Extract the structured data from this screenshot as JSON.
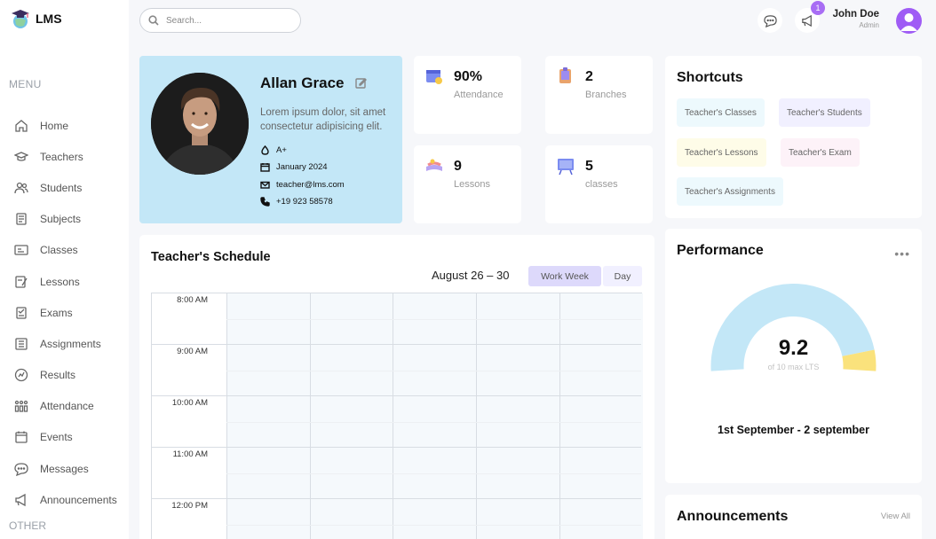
{
  "app": {
    "name": "LMS"
  },
  "sidebar": {
    "menu_title": "MENU",
    "other_title": "OTHER",
    "items": [
      {
        "label": "Home",
        "icon": "home-icon"
      },
      {
        "label": "Teachers",
        "icon": "teacher-icon"
      },
      {
        "label": "Students",
        "icon": "students-icon"
      },
      {
        "label": "Subjects",
        "icon": "subjects-icon"
      },
      {
        "label": "Classes",
        "icon": "classes-icon"
      },
      {
        "label": "Lessons",
        "icon": "lessons-icon"
      },
      {
        "label": "Exams",
        "icon": "exams-icon"
      },
      {
        "label": "Assignments",
        "icon": "assignments-icon"
      },
      {
        "label": "Results",
        "icon": "results-icon"
      },
      {
        "label": "Attendance",
        "icon": "attendance-icon"
      },
      {
        "label": "Events",
        "icon": "events-icon"
      },
      {
        "label": "Messages",
        "icon": "messages-icon"
      },
      {
        "label": "Announcements",
        "icon": "announcements-icon"
      }
    ]
  },
  "topbar": {
    "search_placeholder": "Search...",
    "notification_count": "1",
    "user_name": "John Doe",
    "user_role": "Admin"
  },
  "profile": {
    "name": "Allan Grace",
    "description": "Lorem ipsum dolor, sit amet consectetur adipisicing elit.",
    "blood_type": "A+",
    "date": "January 2024",
    "email": "teacher@lms.com",
    "phone": "+19 923 58578"
  },
  "stats": [
    {
      "value": "90%",
      "label": "Attendance",
      "icon": "attendance-calendar-icon"
    },
    {
      "value": "2",
      "label": "Branches",
      "icon": "branches-icon"
    },
    {
      "value": "9",
      "label": "Lessons",
      "icon": "lessons-book-icon"
    },
    {
      "value": "5",
      "label": "classes",
      "icon": "classes-board-icon"
    }
  ],
  "shortcuts": {
    "title": "Shortcuts",
    "items": [
      {
        "label": "Teacher's Classes",
        "color": "#edf9fd"
      },
      {
        "label": "Teacher's Students",
        "color": "#f1f0ff"
      },
      {
        "label": "Teacher's Lessons",
        "color": "#fefce8"
      },
      {
        "label": "Teacher's Exam",
        "color": "#fdf2f8"
      },
      {
        "label": "Teacher's Assignments",
        "color": "#edf9fd"
      }
    ]
  },
  "schedule": {
    "title": "Teacher's Schedule",
    "range": "August 26 – 30",
    "view_work_week": "Work Week",
    "view_day": "Day",
    "times": [
      "8:00 AM",
      "9:00 AM",
      "10:00 AM",
      "11:00 AM",
      "12:00 PM"
    ]
  },
  "performance": {
    "title": "Performance",
    "value": "9.2",
    "subtitle": "of 10 max LTS",
    "range": "1st September - 2 september",
    "score": 9.2,
    "max": 10,
    "colors": {
      "filled": "#c3e7f7",
      "rest": "#fae27c"
    }
  },
  "announcements": {
    "title": "Announcements",
    "view_all": "View All"
  },
  "colors": {
    "accent": "#a86df4",
    "profile_bg": "#c3e7f7"
  }
}
